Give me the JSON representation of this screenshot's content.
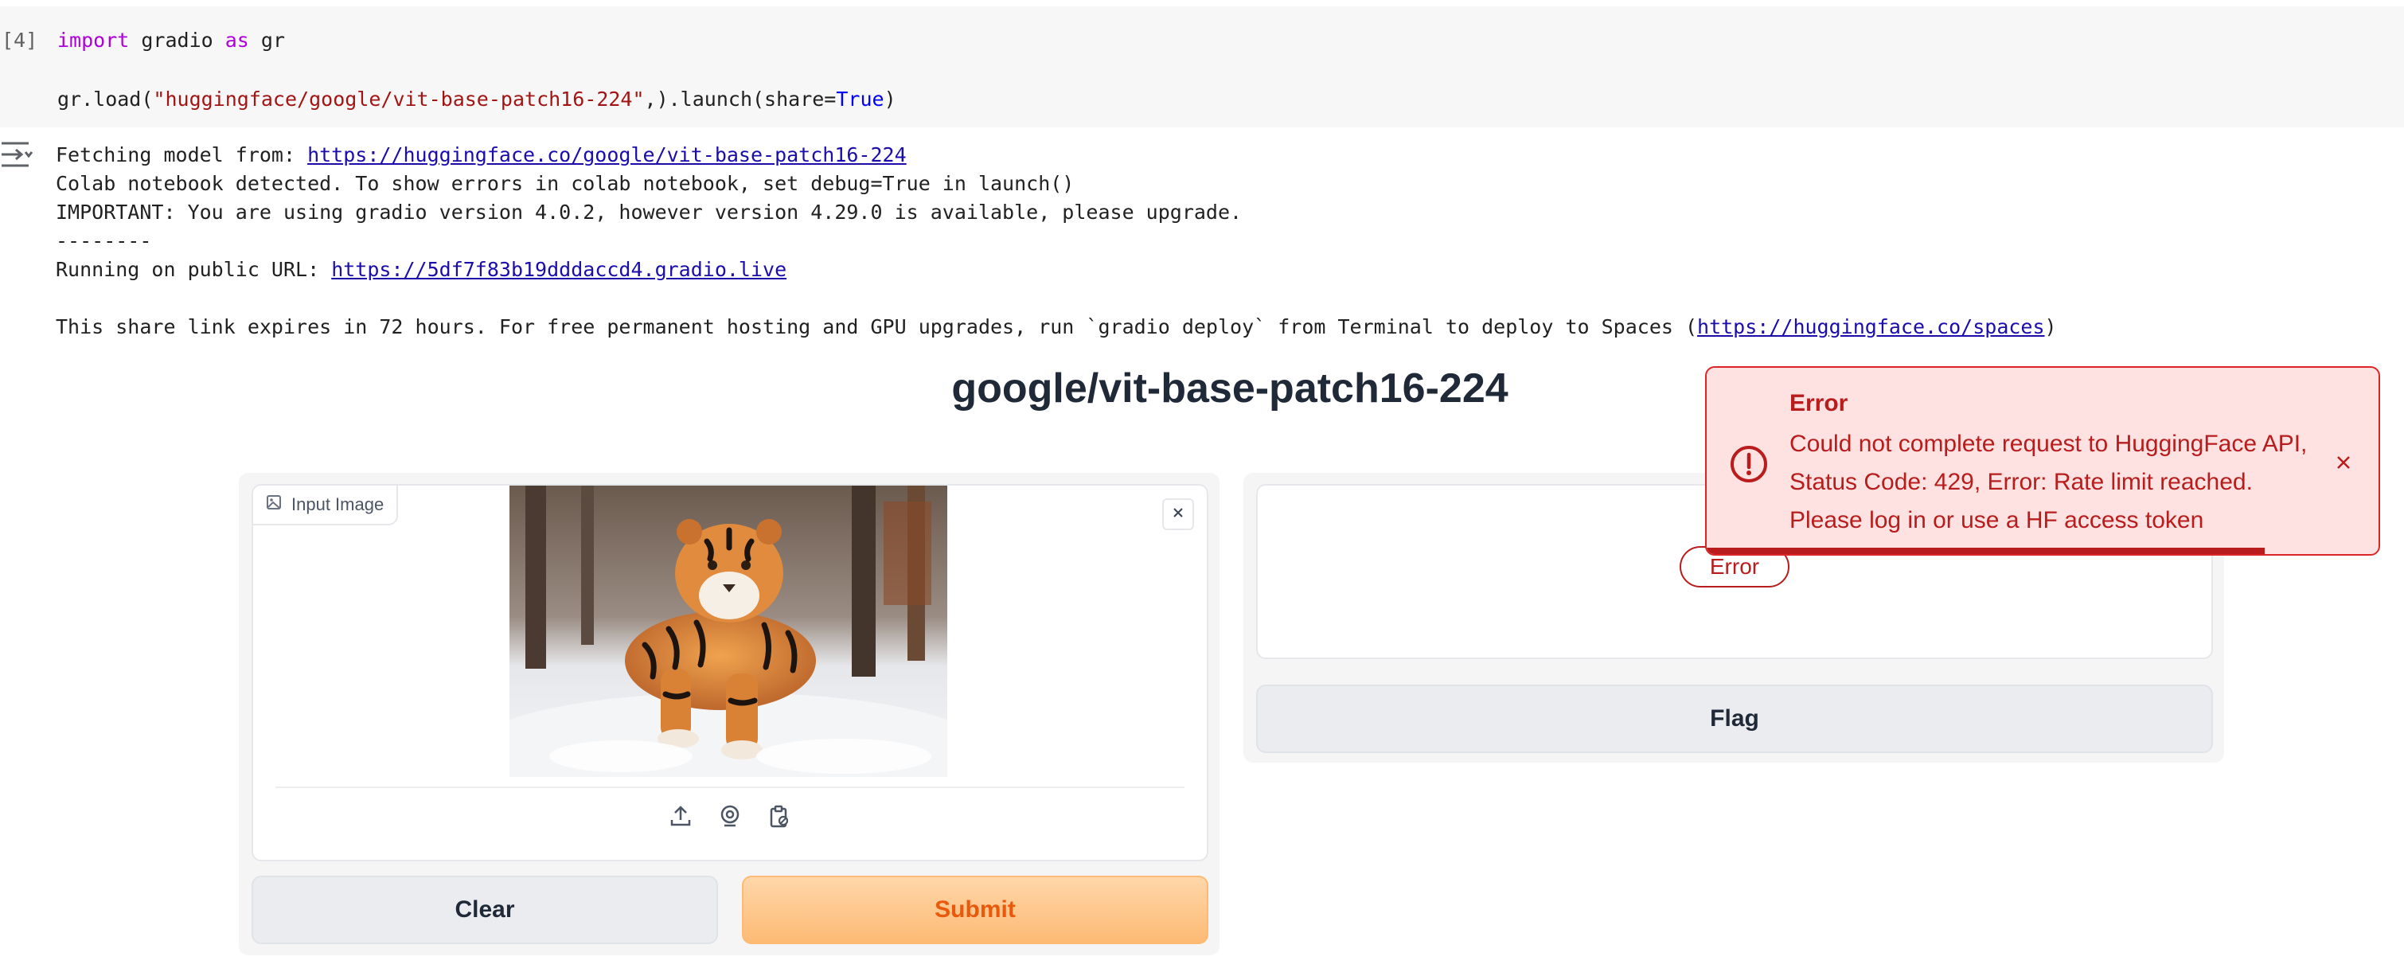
{
  "cell": {
    "execution_count": "[4]",
    "line1": {
      "kw1": "import",
      "mod": "gradio",
      "kw2": "as",
      "alias": "gr"
    },
    "line2": {
      "prefix": "gr.load(",
      "arg": "\"huggingface/google/vit-base-patch16-224\"",
      "mid": ",).launch(share=",
      "bool": "True",
      "suffix": ")"
    }
  },
  "output": {
    "fetching_prefix": "Fetching model from: ",
    "fetching_link": "https://huggingface.co/google/vit-base-patch16-224",
    "colab_notice": "Colab notebook detected. To show errors in colab notebook, set debug=True in launch()",
    "important": "IMPORTANT: You are using gradio version 4.0.2, however version 4.29.0 is available, please upgrade.",
    "separator": "--------",
    "running_prefix": "Running on public URL: ",
    "running_link": "https://5df7f83b19dddaccd4.gradio.live",
    "share_prefix": "This share link expires in 72 hours. For free permanent hosting and GPU upgrades, run `gradio deploy` from Terminal to deploy to Spaces (",
    "share_link": "https://huggingface.co/spaces",
    "share_suffix": ")"
  },
  "app": {
    "title": "google/vit-base-patch16-224",
    "input_label": "Input Image",
    "clear_label": "Clear",
    "submit_label": "Submit",
    "output_error_badge": "Error",
    "flag_label": "Flag"
  },
  "toast": {
    "title": "Error",
    "message": "Could not complete request to HuggingFace API, Status Code: 429, Error: Rate limit reached. Please log in or use a HF access token",
    "progress": 0.83
  },
  "icons": {
    "output_toggle": "output-collapse-icon",
    "image_label": "image-icon",
    "clear_image": "close-icon",
    "upload": "upload-icon",
    "webcam": "webcam-icon",
    "clipboard": "clipboard-icon",
    "toast_alert": "alert-circle-icon",
    "toast_close": "close-icon"
  },
  "colors": {
    "submit_text": "#ea580c",
    "error": "#b91c1c",
    "toast_bg": "#fee2e2",
    "link": "#1a0dab"
  }
}
